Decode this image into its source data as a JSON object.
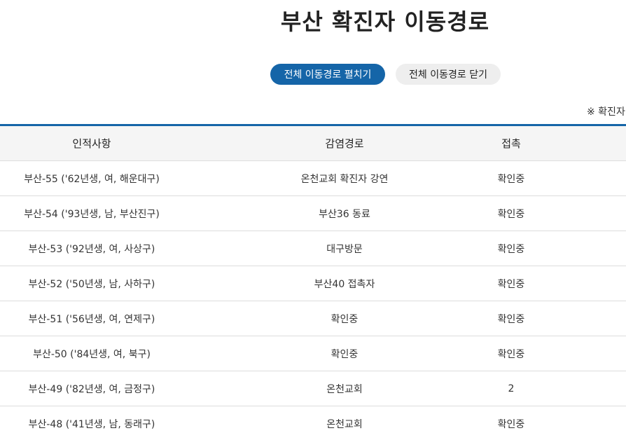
{
  "page": {
    "title": "부산 확진자 이동경로",
    "expand_all_label": "전체 이동경로 펼치기",
    "collapse_all_label": "전체 이동경로 닫기",
    "notice_text": "※ 확진자"
  },
  "table": {
    "headers": {
      "info": "인적사항",
      "route": "감염경로",
      "contact": "접촉"
    },
    "rows": [
      {
        "info": "부산-55 ('62년생, 여, 해운대구)",
        "route": "온천교회 확진자 강연",
        "contact": "확인중"
      },
      {
        "info": "부산-54 ('93년생, 남, 부산진구)",
        "route": "부산36 동료",
        "contact": "확인중"
      },
      {
        "info": "부산-53 ('92년생, 여, 사상구)",
        "route": "대구방문",
        "contact": "확인중"
      },
      {
        "info": "부산-52 ('50년생, 남, 사하구)",
        "route": "부산40 접촉자",
        "contact": "확인중"
      },
      {
        "info": "부산-51 ('56년생, 여, 연제구)",
        "route": "확인중",
        "contact": "확인중"
      },
      {
        "info": "부산-50 ('84년생, 여, 북구)",
        "route": "확인중",
        "contact": "확인중"
      },
      {
        "info": "부산-49 ('82년생, 여, 금정구)",
        "route": "온천교회",
        "contact": "2"
      },
      {
        "info": "부산-48 ('41년생, 남, 동래구)",
        "route": "온천교회",
        "contact": "확인중"
      }
    ]
  },
  "colors": {
    "accent": "#1565a8",
    "header_bg": "#f5f5f5"
  }
}
